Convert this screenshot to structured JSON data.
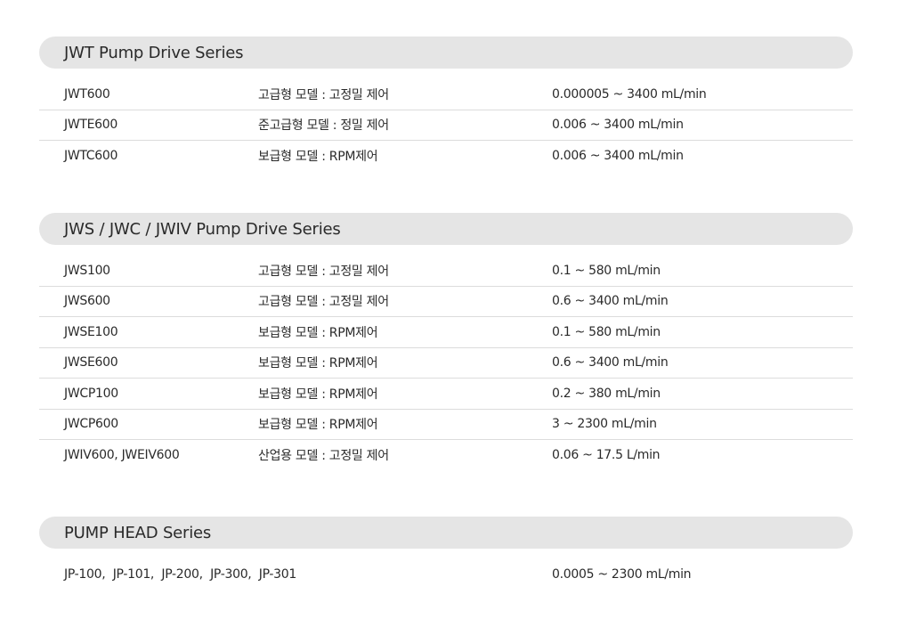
{
  "sections": [
    {
      "title": "JWT Pump Drive Series",
      "rows": [
        {
          "model": "JWT600",
          "desc": "고급형 모델 : 고정밀 제어",
          "range": "0.000005 ~ 3400 mL/min"
        },
        {
          "model": "JWTE600",
          "desc": "준고급형 모델 : 정밀 제어",
          "range": "0.006 ~ 3400 mL/min"
        },
        {
          "model": "JWTC600",
          "desc": "보급형 모델 : RPM제어",
          "range": "0.006 ~ 3400 mL/min"
        }
      ]
    },
    {
      "title": "JWS / JWC / JWIV Pump Drive Series",
      "rows": [
        {
          "model": "JWS100",
          "desc": "고급형 모델 : 고정밀 제어",
          "range": "0.1 ~ 580 mL/min"
        },
        {
          "model": "JWS600",
          "desc": "고급형 모델 : 고정밀 제어",
          "range": "0.6 ~ 3400 mL/min"
        },
        {
          "model": "JWSE100",
          "desc": "보급형 모델 : RPM제어",
          "range": "0.1 ~ 580 mL/min"
        },
        {
          "model": "JWSE600",
          "desc": "보급형 모델 : RPM제어",
          "range": "0.6 ~ 3400 mL/min"
        },
        {
          "model": "JWCP100",
          "desc": "보급형 모델 : RPM제어",
          "range": "0.2 ~ 380 mL/min"
        },
        {
          "model": "JWCP600",
          "desc": "보급형 모델 : RPM제어",
          "range": "3 ~ 2300 mL/min"
        },
        {
          "model": "JWIV600, JWEIV600",
          "desc": "산업용 모델 : 고정밀 제어",
          "range": "0.06 ~ 17.5 L/min"
        }
      ]
    },
    {
      "title": "PUMP HEAD Series",
      "rows": [
        {
          "model": "JP-100,  JP-101,  JP-200,  JP-300,  JP-301",
          "desc": "",
          "range": "0.0005 ~ 2300 mL/min"
        }
      ]
    }
  ]
}
